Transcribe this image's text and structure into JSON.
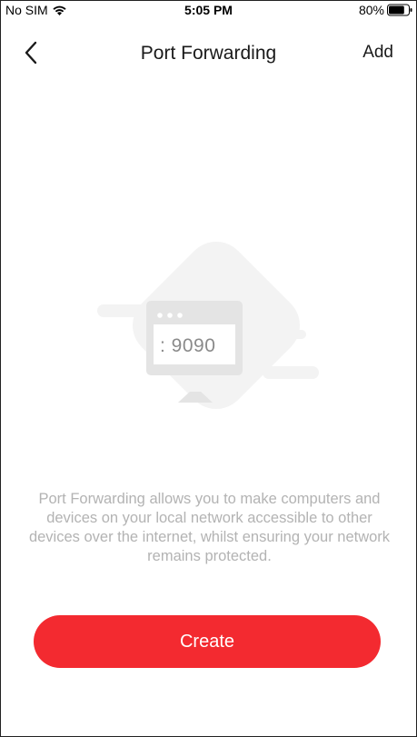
{
  "status_bar": {
    "carrier": "No SIM",
    "time": "5:05 PM",
    "battery": "80%",
    "battery_level": 0.8,
    "icons": [
      "wifi-icon",
      "battery-icon"
    ]
  },
  "nav": {
    "back_icon": "chevron-left-icon",
    "title": "Port Forwarding",
    "add_label": "Add"
  },
  "illustration": {
    "icon": "monitor-icon",
    "port_text": ": 9090"
  },
  "description": "Port Forwarding allows you to make computers and devices on your local network accessible to other devices over the internet, whilst ensuring your network remains protected.",
  "create_label": "Create",
  "colors": {
    "accent": "#f32a30",
    "muted_text": "#b3b3b3",
    "illustration_gray": "#e6e6e6"
  }
}
